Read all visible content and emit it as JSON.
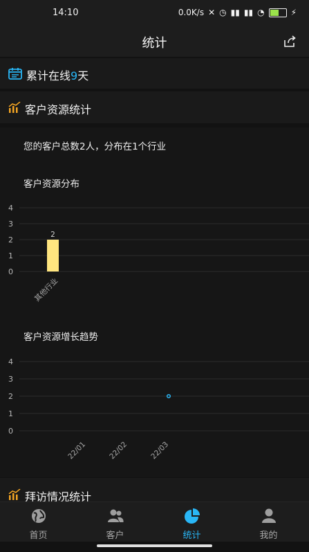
{
  "status": {
    "time": "14:10",
    "speed": "0.0K/s",
    "battery": "53"
  },
  "header": {
    "title": "统计"
  },
  "online": {
    "prefix": "累计在线",
    "days": "9",
    "suffix": "天"
  },
  "customer_section": {
    "title": "客户资源统计"
  },
  "summary": "您的客户总数2人，分布在1个行业",
  "chart_data": [
    {
      "type": "bar",
      "title": "客户资源分布",
      "categories": [
        "其他行业"
      ],
      "values": [
        2
      ],
      "ylim": [
        0,
        4
      ],
      "yticks": [
        "0",
        "1",
        "2",
        "3",
        "4"
      ],
      "grid": true,
      "color": "#ffe57f"
    },
    {
      "type": "line",
      "title": "客户资源增长趋势",
      "categories": [
        "22/01",
        "22/02",
        "22/03"
      ],
      "values": [
        null,
        null,
        2
      ],
      "ylim": [
        0,
        4
      ],
      "yticks": [
        "0",
        "1",
        "2",
        "3",
        "4"
      ],
      "grid": true,
      "color": "#29b6f6"
    }
  ],
  "visit_section": {
    "title": "拜访情况统计"
  },
  "nav": {
    "items": [
      {
        "label": "首页",
        "icon": "globe-icon"
      },
      {
        "label": "客户",
        "icon": "customers-icon"
      },
      {
        "label": "统计",
        "icon": "pie-chart-icon"
      },
      {
        "label": "我的",
        "icon": "person-icon"
      }
    ],
    "active_index": 2,
    "active_color": "#29b6f6"
  }
}
